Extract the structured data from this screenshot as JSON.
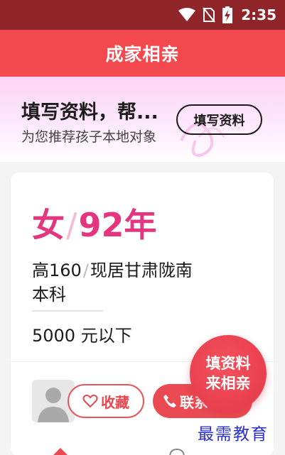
{
  "status_bar": {
    "time": "2:35",
    "icons": [
      "wifi-icon",
      "no-sim-icon",
      "battery-charging-icon"
    ]
  },
  "header": {
    "title": "成家相亲"
  },
  "promo": {
    "title": "填写资料，帮...",
    "subtitle": "为您推荐孩子本地对象",
    "button_label": "填写资料"
  },
  "profile": {
    "gender": "女",
    "year": "92年",
    "separator": "/",
    "height": "高160",
    "location": "现居甘肃陇南",
    "education": "本科",
    "income": "5000 元以下",
    "avatar_icon": "default-avatar-icon"
  },
  "actions": {
    "favorite_label": "收藏",
    "favorite_icon": "heart-outline-icon",
    "contact_label": "联系",
    "contact_icon": "phone-icon"
  },
  "fab": {
    "line1": "填资料",
    "line2": "来相亲"
  },
  "watermark": {
    "text": "最需教育"
  },
  "colors": {
    "status_bar": "#8f2528",
    "header": "#f2484e",
    "accent_pink": "#e4357f",
    "button_red": "#ec4a52"
  }
}
